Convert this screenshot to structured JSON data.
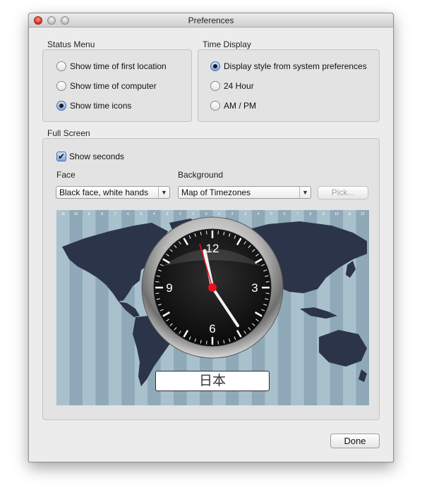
{
  "window": {
    "title": "Preferences"
  },
  "status_menu": {
    "label": "Status Menu",
    "options": [
      {
        "label": "Show time of first location",
        "selected": false
      },
      {
        "label": "Show time of computer",
        "selected": false
      },
      {
        "label": "Show time icons",
        "selected": true
      }
    ]
  },
  "time_display": {
    "label": "Time Display",
    "options": [
      {
        "label": "Display style from system preferences",
        "selected": true
      },
      {
        "label": "24 Hour",
        "selected": false
      },
      {
        "label": "AM / PM",
        "selected": false
      }
    ]
  },
  "full_screen": {
    "label": "Full Screen",
    "show_seconds": {
      "label": "Show seconds",
      "checked": true
    },
    "face": {
      "label": "Face",
      "value": "Black face, white hands"
    },
    "background": {
      "label": "Background",
      "value": "Map of Timezones",
      "pick_label": "Pick..."
    },
    "preview": {
      "clock_numerals": [
        "12",
        "3",
        "6",
        "9"
      ],
      "location": "日本",
      "zone_labels": [
        "11",
        "10",
        "9",
        "8",
        "7",
        "6",
        "5",
        "4",
        "3",
        "2",
        "1",
        "0",
        "1",
        "2",
        "3",
        "4",
        "5",
        "6",
        "7",
        "8",
        "9",
        "10",
        "11",
        "12"
      ]
    }
  },
  "done_label": "Done",
  "colors": {
    "accent": "#3478d4",
    "map_land": "#2b3448",
    "second_hand": "#e8111b"
  }
}
